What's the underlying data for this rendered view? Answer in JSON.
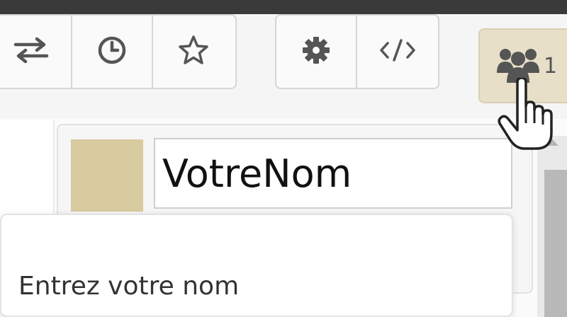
{
  "toolbar": {
    "group1": [
      {
        "icon": "swap-arrows-icon"
      },
      {
        "icon": "history-clock-icon"
      },
      {
        "icon": "star-icon"
      }
    ],
    "group2": [
      {
        "icon": "gear-icon"
      },
      {
        "icon": "code-icon"
      }
    ],
    "users": {
      "icon": "users-icon",
      "count": "1",
      "color": "#e7dfc7"
    }
  },
  "profile": {
    "color_swatch": "#d8cba0",
    "name_value": "VotreNom"
  },
  "tooltip": {
    "text": "Entrez votre nom"
  }
}
